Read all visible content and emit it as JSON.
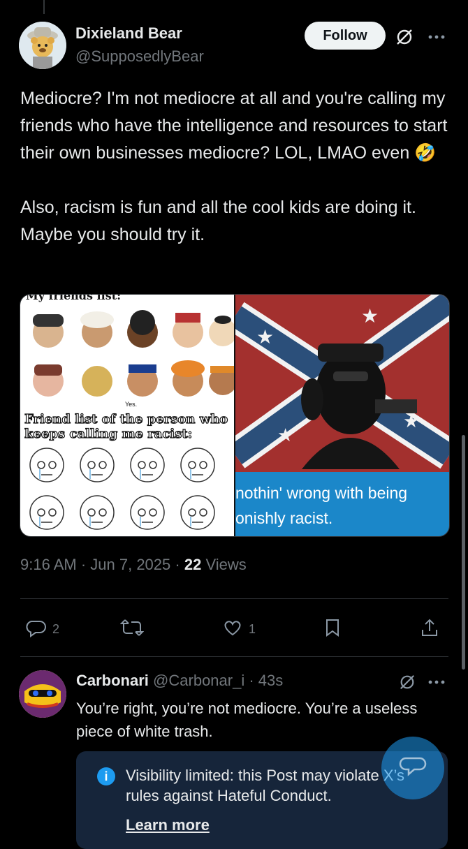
{
  "post": {
    "display_name": "Dixieland Bear",
    "handle": "@SupposedlyBear",
    "follow_label": "Follow",
    "text": "Mediocre? I'm not mediocre at all and you're calling my friends who have the intelligence and resources to start their own businesses mediocre? LOL, LMAO even 🤣\n\nAlso, racism is fun and all the cool kids are doing it. Maybe you should try it.",
    "media": {
      "left_top_caption": "My friends list:",
      "left_caption": "Friend list of the person who keeps calling me racist:",
      "left_small": "Yes.",
      "right_caption": "nothin' wrong with being\nonishly racist."
    },
    "time": "9:16 AM",
    "date": "Jun 7, 2025",
    "views_count": "22",
    "views_label": "Views"
  },
  "actions": {
    "replies": "2",
    "reposts": "",
    "likes": "1"
  },
  "reply": {
    "display_name": "Carbonari",
    "handle": "@Carbonar_i",
    "time": "43s",
    "text": "You’re right, you’re not mediocre. You’re a useless piece of white trash.",
    "notice_text": "Visibility limited: this Post may violate X’s rules against Hateful Conduct.",
    "learn_more": "Learn more"
  },
  "colors": {
    "background": "#000000",
    "muted": "#71767b",
    "accent": "#1d9bf0"
  }
}
